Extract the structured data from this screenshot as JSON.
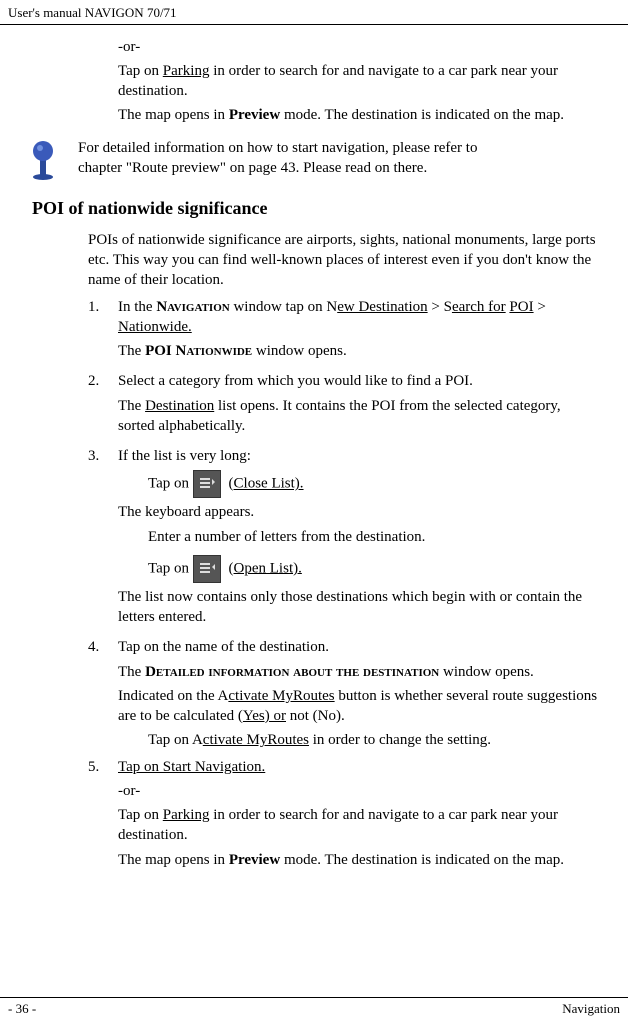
{
  "header": {
    "title": "User's manual NAVIGON 70/71"
  },
  "topBlock": {
    "or": "-or-",
    "parking": "Tap on <u>Parking</u> in order to search for and navigate to a car park near your destination.",
    "preview": "The map opens in <b>Preview</b> mode. The destination is indicated on the map."
  },
  "infoNote": {
    "line1": "For detailed information on how to start navigation, please refer to",
    "line2": "chapter \"Route preview\" on page 43. Please read on there."
  },
  "sectionTitle": "POI of nationwide significance",
  "intro": "POIs of nationwide significance are airports, sights, national monuments, large ports etc. This way you can find well-known places of interest even if you don't know the name of their location.",
  "steps": {
    "s1a": "In the <b><span class=\"smallcaps\">Navigation</span></b> window tap on N<u>ew Destination</u> > S<u>earch for</u> <u>POI</u> > <u>Nationwide.</u>",
    "s1b": "The <b>POI <span class=\"smallcaps\">Nationwide</span></b> window opens.",
    "s2a": "Select a category from which you would like to find a POI.",
    "s2b": "The <u>Destination</u> list opens. It contains the POI from the selected category, sorted alphabetically.",
    "s3a": "If the list is very long:",
    "s3_closeList": " (<u>Close List).</u>",
    "s3_kb": "The keyboard appears.",
    "s3_enter": "Enter a number of letters from the destination.",
    "s3_openList": " (<u>Open List).</u>",
    "s3_listNow": "The list now contains only those destinations which begin with or contain the letters entered.",
    "s4a": "Tap on the name of the destination.",
    "s4b": "The <b><span class=\"smallcaps\">Detailed information about the destination</span></b> window opens.",
    "s4c": "Indicated on the A<u>ctivate MyRoutes</u> button is whether several route suggestions are to be calculated (<u>Yes) or</u> not (No).",
    "s4d": "Tap on A<u>ctivate MyRoutes</u> in order to change the setting.",
    "s5a": "<u>Tap on Start Navigation.</u>",
    "s5or": "-or-",
    "s5b": "Tap on <u>Parking</u> in order to search for and navigate to a car park near your destination.",
    "s5c": "The map opens in <b>Preview</b> mode. The destination is indicated on the map."
  },
  "tapOn": "Tap on ",
  "footer": {
    "left": "- 36 -",
    "right": "Navigation"
  }
}
